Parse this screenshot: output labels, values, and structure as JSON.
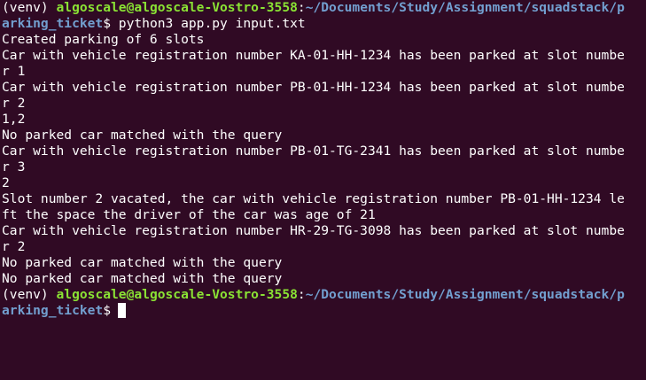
{
  "prompt_1": {
    "venv": "(venv) ",
    "user_host": "algoscale@algoscale-Vostro-3558",
    "colon": ":",
    "path_line1": "~/Documents/Study/Assignment/squadstack/p",
    "path_line2": "arking_ticket",
    "symbol_and_command": "$ python3 app.py input.txt"
  },
  "output_lines": [
    "Created parking of 6 slots",
    "Car with vehicle registration number KA-01-HH-1234 has been parked at slot numbe",
    "r 1",
    "Car with vehicle registration number PB-01-HH-1234 has been parked at slot numbe",
    "r 2",
    "1,2",
    "No parked car matched with the query",
    "Car with vehicle registration number PB-01-TG-2341 has been parked at slot numbe",
    "r 3",
    "2",
    "Slot number 2 vacated, the car with vehicle registration number PB-01-HH-1234 le",
    "ft the space the driver of the car was age of 21",
    "Car with vehicle registration number HR-29-TG-3098 has been parked at slot numbe",
    "r 2",
    "No parked car matched with the query",
    "No parked car matched with the query"
  ],
  "prompt_2": {
    "venv": "(venv) ",
    "user_host": "algoscale@algoscale-Vostro-3558",
    "colon": ":",
    "path_line1": "~/Documents/Study/Assignment/squadstack/p",
    "path_line2": "arking_ticket",
    "symbol": "$"
  },
  "colors": {
    "background": "#300a24",
    "text": "#ffffff",
    "user_host": "#8ae234",
    "path": "#729fcf"
  }
}
